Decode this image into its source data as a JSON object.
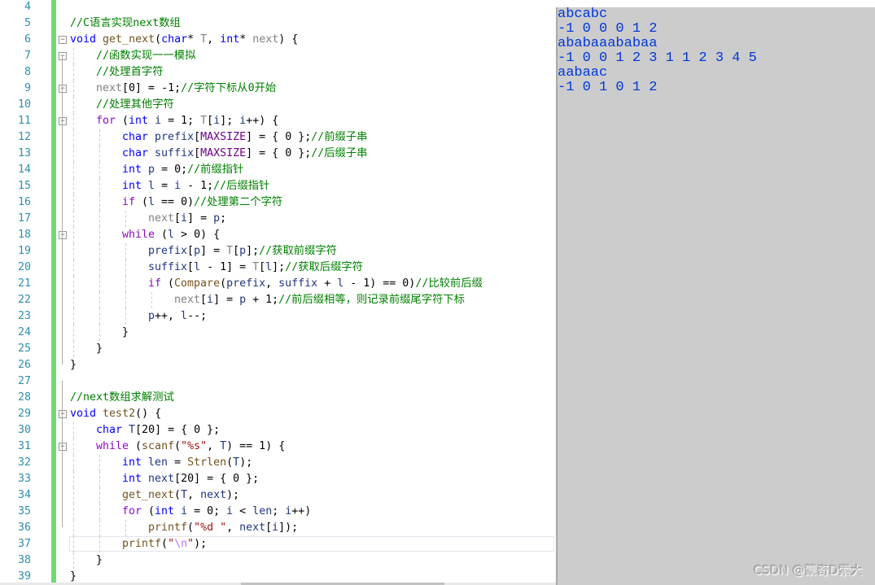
{
  "editor": {
    "lines": [
      {
        "n": "4",
        "indent": 0,
        "tokens": []
      },
      {
        "n": "5",
        "indent": 0,
        "tokens": [
          [
            "m",
            "//C语言实现next数组"
          ]
        ]
      },
      {
        "n": "6",
        "indent": 0,
        "fold": true,
        "tokens": [
          [
            "k",
            "void"
          ],
          [
            "t",
            " "
          ],
          [
            "f",
            "get_next"
          ],
          [
            "t",
            "("
          ],
          [
            "k",
            "char"
          ],
          [
            "t",
            "* "
          ],
          [
            "p",
            "T"
          ],
          [
            "t",
            ", "
          ],
          [
            "k",
            "int"
          ],
          [
            "t",
            "* "
          ],
          [
            "p",
            "next"
          ],
          [
            "t",
            ") {"
          ]
        ]
      },
      {
        "n": "7",
        "indent": 1,
        "fold": true,
        "tokens": [
          [
            "m",
            "//函数实现一一模拟"
          ]
        ]
      },
      {
        "n": "8",
        "indent": 1,
        "tokens": [
          [
            "m",
            "//处理首字符"
          ]
        ]
      },
      {
        "n": "9",
        "indent": 1,
        "fold": true,
        "tokens": [
          [
            "p",
            "next"
          ],
          [
            "t",
            "[0] = -1;"
          ],
          [
            "m",
            "//字符下标从0开始"
          ]
        ]
      },
      {
        "n": "10",
        "indent": 1,
        "tokens": [
          [
            "m",
            "//处理其他字符"
          ]
        ]
      },
      {
        "n": "11",
        "indent": 1,
        "fold": true,
        "tokens": [
          [
            "c",
            "for"
          ],
          [
            "t",
            " ("
          ],
          [
            "k",
            "int"
          ],
          [
            "t",
            " "
          ],
          [
            "v",
            "i"
          ],
          [
            "t",
            " = 1; "
          ],
          [
            "p",
            "T"
          ],
          [
            "t",
            "["
          ],
          [
            "v",
            "i"
          ],
          [
            "t",
            "]; "
          ],
          [
            "v",
            "i"
          ],
          [
            "t",
            "++) {"
          ]
        ]
      },
      {
        "n": "12",
        "indent": 2,
        "tokens": [
          [
            "k",
            "char"
          ],
          [
            "t",
            " "
          ],
          [
            "v",
            "prefix"
          ],
          [
            "t",
            "["
          ],
          [
            "d",
            "MAXSIZE"
          ],
          [
            "t",
            "] = { 0 };"
          ],
          [
            "m",
            "//前缀子串"
          ]
        ]
      },
      {
        "n": "13",
        "indent": 2,
        "tokens": [
          [
            "k",
            "char"
          ],
          [
            "t",
            " "
          ],
          [
            "v",
            "suffix"
          ],
          [
            "t",
            "["
          ],
          [
            "d",
            "MAXSIZE"
          ],
          [
            "t",
            "] = { 0 };"
          ],
          [
            "m",
            "//后缀子串"
          ]
        ]
      },
      {
        "n": "14",
        "indent": 2,
        "tokens": [
          [
            "k",
            "int"
          ],
          [
            "t",
            " "
          ],
          [
            "v",
            "p"
          ],
          [
            "t",
            " = 0;"
          ],
          [
            "m",
            "//前缀指针"
          ]
        ]
      },
      {
        "n": "15",
        "indent": 2,
        "tokens": [
          [
            "k",
            "int"
          ],
          [
            "t",
            " "
          ],
          [
            "v",
            "l"
          ],
          [
            "t",
            " = "
          ],
          [
            "v",
            "i"
          ],
          [
            "t",
            " - 1;"
          ],
          [
            "m",
            "//后缀指针"
          ]
        ]
      },
      {
        "n": "16",
        "indent": 2,
        "tokens": [
          [
            "c",
            "if"
          ],
          [
            "t",
            " ("
          ],
          [
            "v",
            "l"
          ],
          [
            "t",
            " == 0)"
          ],
          [
            "m",
            "//处理第二个字符"
          ]
        ]
      },
      {
        "n": "17",
        "indent": 3,
        "tokens": [
          [
            "p",
            "next"
          ],
          [
            "t",
            "["
          ],
          [
            "v",
            "i"
          ],
          [
            "t",
            "] = "
          ],
          [
            "v",
            "p"
          ],
          [
            "t",
            ";"
          ]
        ]
      },
      {
        "n": "18",
        "indent": 2,
        "fold": true,
        "tokens": [
          [
            "c",
            "while"
          ],
          [
            "t",
            " ("
          ],
          [
            "v",
            "l"
          ],
          [
            "t",
            " > 0) {"
          ]
        ]
      },
      {
        "n": "19",
        "indent": 3,
        "tokens": [
          [
            "v",
            "prefix"
          ],
          [
            "t",
            "["
          ],
          [
            "v",
            "p"
          ],
          [
            "t",
            "] = "
          ],
          [
            "p",
            "T"
          ],
          [
            "t",
            "["
          ],
          [
            "v",
            "p"
          ],
          [
            "t",
            "];"
          ],
          [
            "m",
            "//获取前缀字符"
          ]
        ]
      },
      {
        "n": "20",
        "indent": 3,
        "tokens": [
          [
            "v",
            "suffix"
          ],
          [
            "t",
            "["
          ],
          [
            "v",
            "l"
          ],
          [
            "t",
            " - 1] = "
          ],
          [
            "p",
            "T"
          ],
          [
            "t",
            "["
          ],
          [
            "v",
            "l"
          ],
          [
            "t",
            "];"
          ],
          [
            "m",
            "//获取后缀字符"
          ]
        ]
      },
      {
        "n": "21",
        "indent": 3,
        "tokens": [
          [
            "c",
            "if"
          ],
          [
            "t",
            " ("
          ],
          [
            "f",
            "Compare"
          ],
          [
            "t",
            "("
          ],
          [
            "v",
            "prefix"
          ],
          [
            "t",
            ", "
          ],
          [
            "v",
            "suffix"
          ],
          [
            "t",
            " + "
          ],
          [
            "v",
            "l"
          ],
          [
            "t",
            " - 1) == 0)"
          ],
          [
            "m",
            "//比较前后缀"
          ]
        ]
      },
      {
        "n": "22",
        "indent": 4,
        "tokens": [
          [
            "p",
            "next"
          ],
          [
            "t",
            "["
          ],
          [
            "v",
            "i"
          ],
          [
            "t",
            "] = "
          ],
          [
            "v",
            "p"
          ],
          [
            "t",
            " + 1;"
          ],
          [
            "m",
            "//前后缀相等，则记录前缀尾字符下标"
          ]
        ]
      },
      {
        "n": "23",
        "indent": 3,
        "tokens": [
          [
            "v",
            "p"
          ],
          [
            "t",
            "++, "
          ],
          [
            "v",
            "l"
          ],
          [
            "t",
            "--;"
          ]
        ]
      },
      {
        "n": "24",
        "indent": 2,
        "tokens": [
          [
            "t",
            "}"
          ]
        ]
      },
      {
        "n": "25",
        "indent": 1,
        "tokens": [
          [
            "t",
            "}"
          ]
        ]
      },
      {
        "n": "26",
        "indent": 0,
        "tokens": [
          [
            "t",
            "}"
          ]
        ]
      },
      {
        "n": "27",
        "indent": 0,
        "tokens": []
      },
      {
        "n": "28",
        "indent": 0,
        "tokens": [
          [
            "m",
            "//next数组求解测试"
          ]
        ]
      },
      {
        "n": "29",
        "indent": 0,
        "fold": true,
        "tokens": [
          [
            "k",
            "void"
          ],
          [
            "t",
            " "
          ],
          [
            "f",
            "test2"
          ],
          [
            "t",
            "() {"
          ]
        ]
      },
      {
        "n": "30",
        "indent": 1,
        "tokens": [
          [
            "k",
            "char"
          ],
          [
            "t",
            " "
          ],
          [
            "v",
            "T"
          ],
          [
            "t",
            "[20] = { 0 };"
          ]
        ]
      },
      {
        "n": "31",
        "indent": 1,
        "fold": true,
        "tokens": [
          [
            "c",
            "while"
          ],
          [
            "t",
            " ("
          ],
          [
            "f",
            "scanf"
          ],
          [
            "t",
            "("
          ],
          [
            "s",
            "\"%s\""
          ],
          [
            "t",
            ", "
          ],
          [
            "v",
            "T"
          ],
          [
            "t",
            ") == 1) {"
          ]
        ]
      },
      {
        "n": "32",
        "indent": 2,
        "tokens": [
          [
            "k",
            "int"
          ],
          [
            "t",
            " "
          ],
          [
            "v",
            "len"
          ],
          [
            "t",
            " = "
          ],
          [
            "f",
            "Strlen"
          ],
          [
            "t",
            "("
          ],
          [
            "v",
            "T"
          ],
          [
            "t",
            ");"
          ]
        ]
      },
      {
        "n": "33",
        "indent": 2,
        "tokens": [
          [
            "k",
            "int"
          ],
          [
            "t",
            " "
          ],
          [
            "v",
            "next"
          ],
          [
            "t",
            "[20] = { 0 };"
          ]
        ]
      },
      {
        "n": "34",
        "indent": 2,
        "tokens": [
          [
            "f",
            "get_next"
          ],
          [
            "t",
            "("
          ],
          [
            "v",
            "T"
          ],
          [
            "t",
            ", "
          ],
          [
            "v",
            "next"
          ],
          [
            "t",
            ");"
          ]
        ]
      },
      {
        "n": "35",
        "indent": 2,
        "tokens": [
          [
            "c",
            "for"
          ],
          [
            "t",
            " ("
          ],
          [
            "k",
            "int"
          ],
          [
            "t",
            " "
          ],
          [
            "v",
            "i"
          ],
          [
            "t",
            " = 0; "
          ],
          [
            "v",
            "i"
          ],
          [
            "t",
            " < "
          ],
          [
            "v",
            "len"
          ],
          [
            "t",
            "; "
          ],
          [
            "v",
            "i"
          ],
          [
            "t",
            "++)"
          ]
        ]
      },
      {
        "n": "36",
        "indent": 3,
        "tokens": [
          [
            "f",
            "printf"
          ],
          [
            "t",
            "("
          ],
          [
            "s",
            "\"%d \""
          ],
          [
            "t",
            ", "
          ],
          [
            "v",
            "next"
          ],
          [
            "t",
            "["
          ],
          [
            "v",
            "i"
          ],
          [
            "t",
            "]);"
          ]
        ]
      },
      {
        "n": "37",
        "indent": 2,
        "tokens": [
          [
            "f",
            "printf"
          ],
          [
            "t",
            "("
          ],
          [
            "s",
            "\""
          ],
          [
            "e",
            "\\n"
          ],
          [
            "s",
            "\""
          ],
          [
            "t",
            ");"
          ]
        ]
      },
      {
        "n": "38",
        "indent": 1,
        "tokens": [
          [
            "t",
            "}"
          ]
        ]
      },
      {
        "n": "39",
        "indent": 0,
        "tokens": [
          [
            "t",
            "}"
          ]
        ]
      }
    ]
  },
  "console": {
    "lines": [
      "abcabc",
      "-1 0 0 0 1 2",
      "ababaaababaa",
      "-1 0 0 1 2 3 1 1 2 3 4 5",
      "aabaac",
      "-1 0 1 0 1 2"
    ],
    "text_color": "#0037da",
    "background": "#cccccc"
  },
  "watermark": "CSDN @蒙奇D索大"
}
